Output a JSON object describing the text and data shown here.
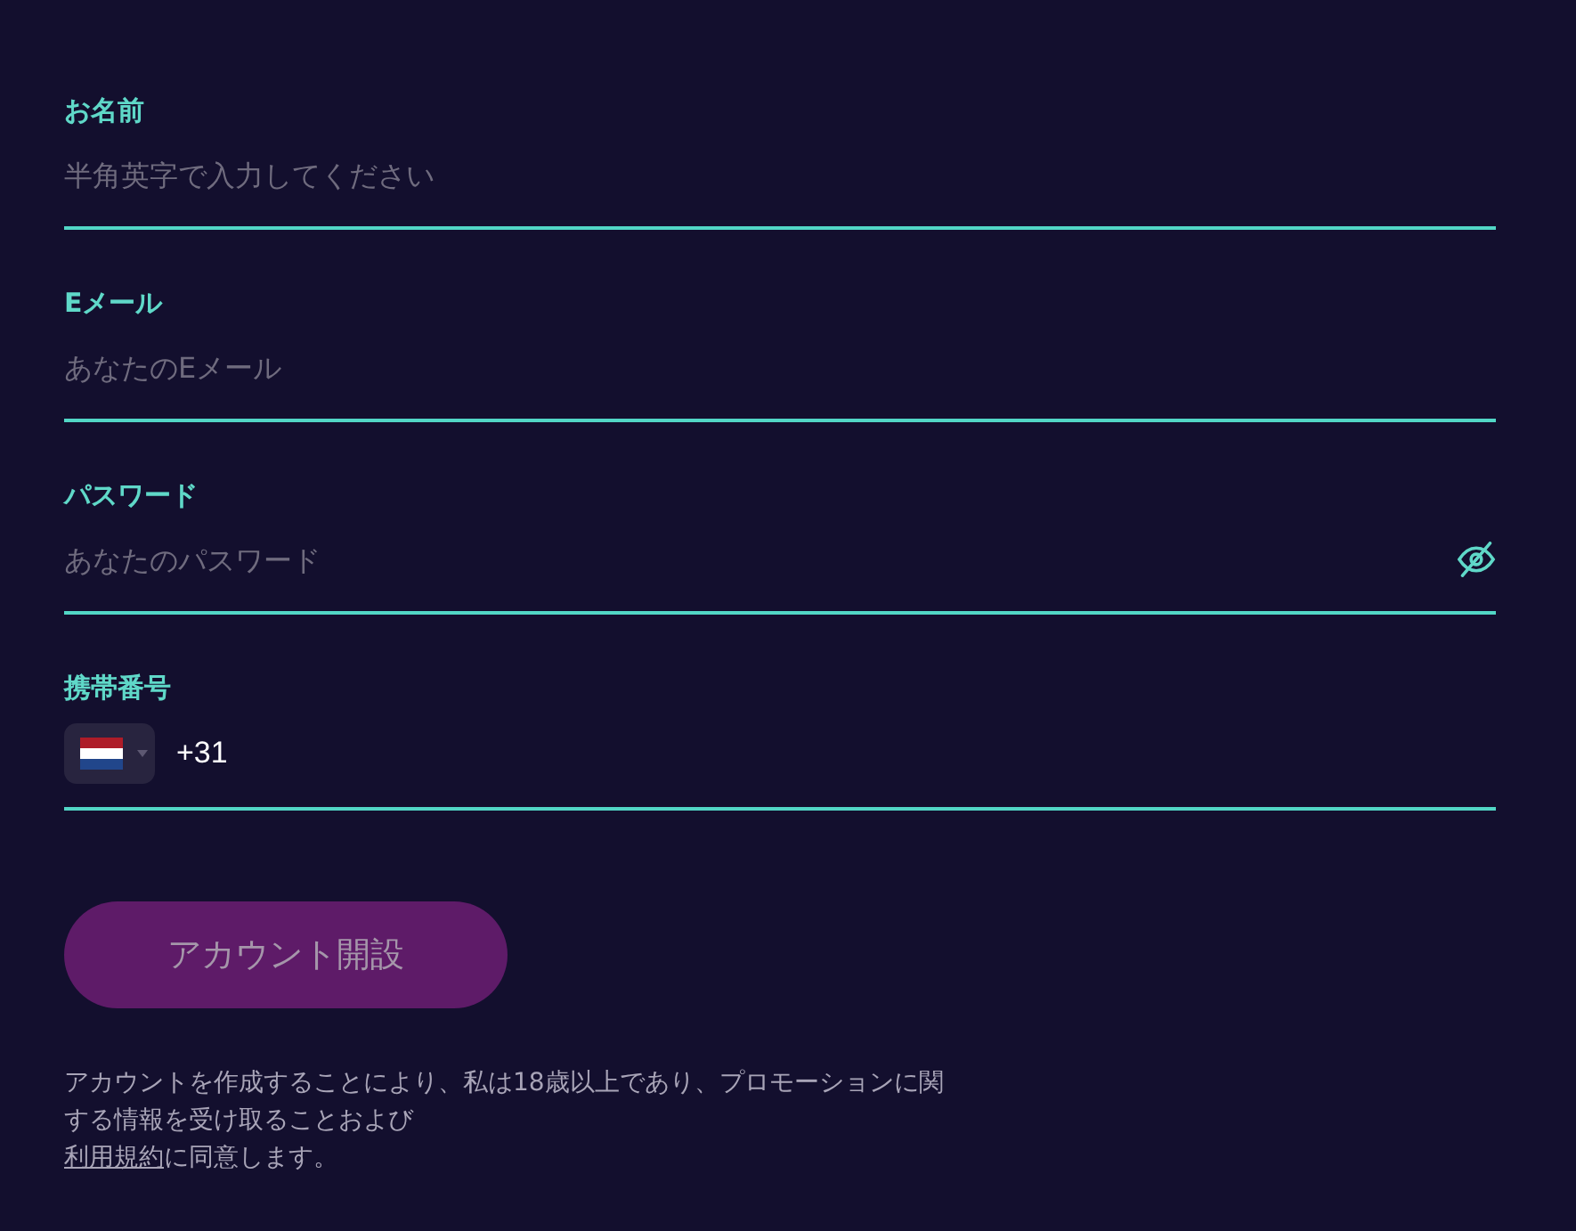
{
  "form": {
    "fields": [
      {
        "kind": "text",
        "label": "お名前",
        "placeholder": "半角英字で入力してください"
      },
      {
        "kind": "text",
        "label": "Eメール",
        "placeholder": "あなたのEメール"
      },
      {
        "kind": "password",
        "label": "パスワード",
        "placeholder": "あなたのパスワード"
      },
      {
        "kind": "phone",
        "label": "携帯番号",
        "value": "+31"
      }
    ],
    "submit_button": {
      "label": "アカウント開設",
      "disabled": true
    }
  },
  "legal_text": {
    "text": "アカウントを作成することにより、私は18歳以上であり、プロモーションに関する情報を受け取ることおよび",
    "link": "利用規約",
    "suffix": "に同意します。"
  }
}
